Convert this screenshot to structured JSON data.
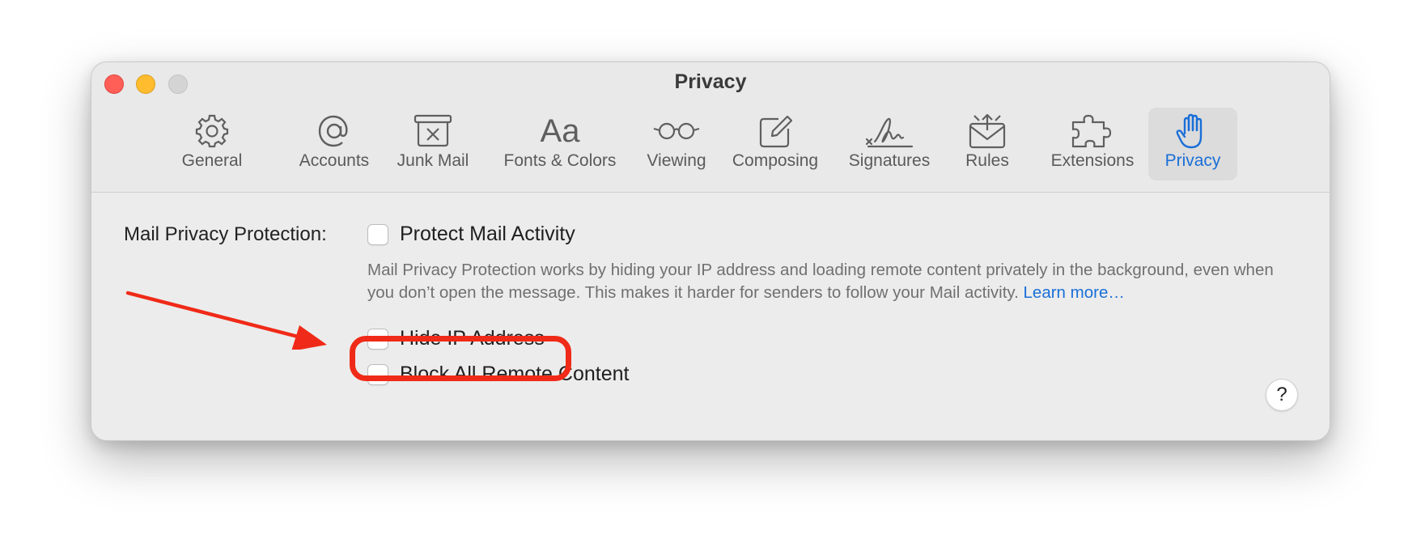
{
  "window": {
    "title": "Privacy"
  },
  "toolbar": {
    "tabs": [
      {
        "label": "General",
        "icon": "gear-icon"
      },
      {
        "label": "Accounts",
        "icon": "at-sign-icon"
      },
      {
        "label": "Junk Mail",
        "icon": "junk-mail-icon"
      },
      {
        "label": "Fonts & Colors",
        "icon": "fonts-icon",
        "glyph": "Aa"
      },
      {
        "label": "Viewing",
        "icon": "glasses-icon"
      },
      {
        "label": "Composing",
        "icon": "compose-icon"
      },
      {
        "label": "Signatures",
        "icon": "signature-icon"
      },
      {
        "label": "Rules",
        "icon": "rules-icon"
      },
      {
        "label": "Extensions",
        "icon": "puzzle-icon"
      },
      {
        "label": "Privacy",
        "icon": "hand-icon",
        "active": true
      }
    ]
  },
  "privacy": {
    "field_label": "Mail Privacy Protection:",
    "protect_mail_activity": {
      "label": "Protect Mail Activity",
      "checked": false
    },
    "description": "Mail Privacy Protection works by hiding your IP address and loading remote content privately in the background, even when you don’t open the message. This makes it harder for senders to follow your Mail activity.",
    "learn_more": "Learn more…",
    "hide_ip_address": {
      "label": "Hide IP Address",
      "checked": false
    },
    "block_remote_content": {
      "label": "Block All Remote Content",
      "checked": false
    },
    "help_label": "?"
  },
  "annotation": {
    "color": "#f02a18"
  },
  "colors": {
    "accent": "#1a6fd8",
    "close": "#ff5f57",
    "minimize": "#febc2e",
    "zoom_disabled": "#d4d4d4"
  }
}
